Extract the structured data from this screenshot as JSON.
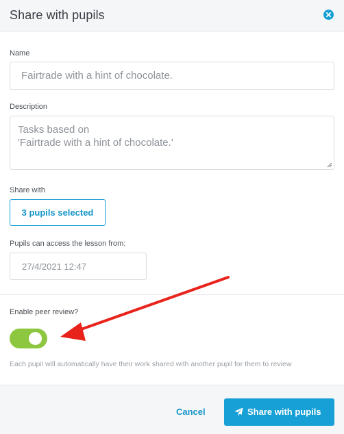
{
  "header": {
    "title": "Share with pupils",
    "close_icon": "close-circle-icon",
    "accent": "#17a0d6"
  },
  "form": {
    "name_label": "Name",
    "name_value": "Fairtrade with a hint of chocolate.",
    "description_label": "Description",
    "description_line1": "Tasks based on",
    "description_line2": "'Fairtrade with a hint of chocolate.'",
    "share_with_label": "Share with",
    "pupils_button": "3 pupils selected",
    "access_label": "Pupils can access the lesson from:",
    "access_value": "27/4/2021 12:47",
    "peer_review_label": "Enable peer review?",
    "peer_review_enabled": true,
    "toggle_color": "#8dc63f",
    "peer_review_hint": "Each pupil will automatically have their work shared with another pupil for them to review"
  },
  "footer": {
    "cancel_label": "Cancel",
    "share_label": "Share with pupils",
    "share_icon": "paper-plane-icon"
  },
  "annotation": {
    "arrow_color": "#e8231c"
  }
}
